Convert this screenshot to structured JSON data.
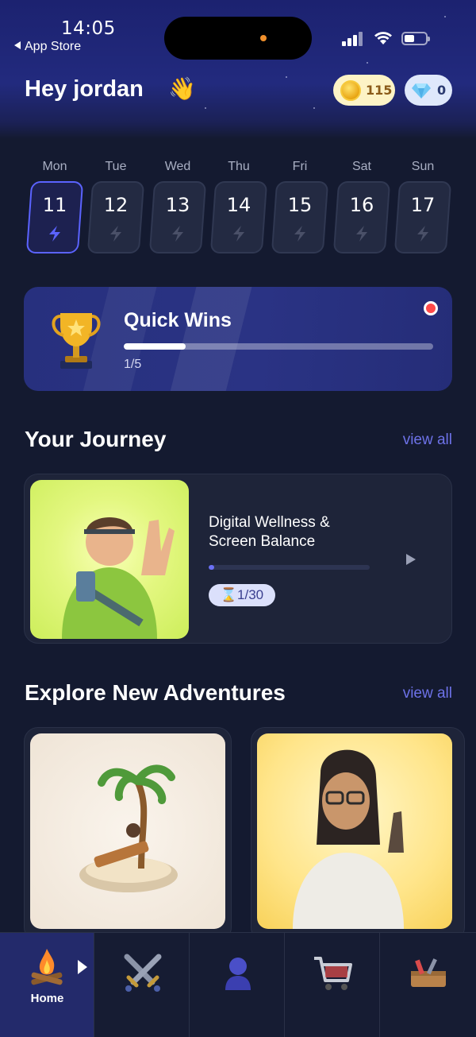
{
  "status_bar": {
    "time": "14:05",
    "back_label": "App Store"
  },
  "header": {
    "greeting": "Hey jordan",
    "wave_emoji": "👋",
    "coins": "115",
    "gems": "0"
  },
  "week": {
    "days": [
      {
        "label": "Mon",
        "date": "11",
        "active": true
      },
      {
        "label": "Tue",
        "date": "12",
        "active": false
      },
      {
        "label": "Wed",
        "date": "13",
        "active": false
      },
      {
        "label": "Thu",
        "date": "14",
        "active": false
      },
      {
        "label": "Fri",
        "date": "15",
        "active": false
      },
      {
        "label": "Sat",
        "date": "16",
        "active": false
      },
      {
        "label": "Sun",
        "date": "17",
        "active": false
      }
    ]
  },
  "quick_wins": {
    "title": "Quick Wins",
    "progress_text": "1/5",
    "progress_fraction": 0.2
  },
  "journey": {
    "section_title": "Your Journey",
    "view_all": "view all",
    "card": {
      "title": "Digital Wellness & Screen Balance",
      "badge": "⌛1/30",
      "progress_fraction": 0.033
    }
  },
  "adventures": {
    "section_title": "Explore New Adventures",
    "view_all": "view all"
  },
  "nav": {
    "home_label": "Home"
  },
  "colors": {
    "accent": "#6d72e8",
    "background": "#141a30",
    "active_nav": "#232a6b"
  }
}
